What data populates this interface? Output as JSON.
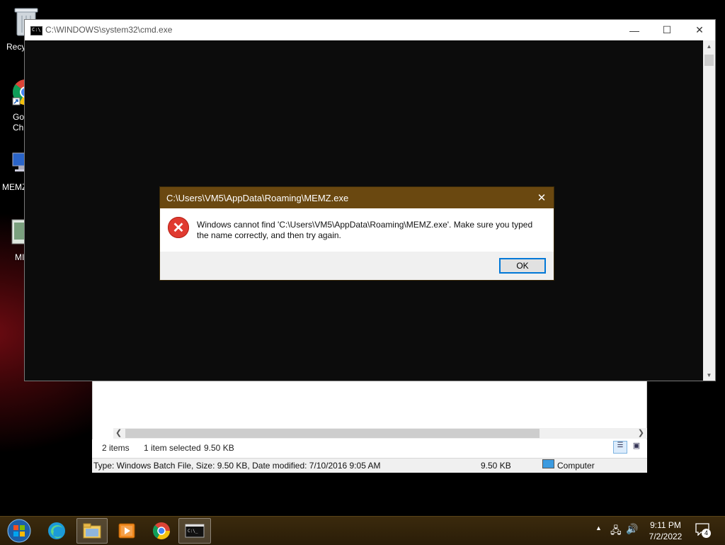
{
  "desktop": {
    "icons": [
      {
        "name": "recycle-bin",
        "label": "Recy"
      },
      {
        "name": "google-chrome",
        "label": "Go\nChr"
      },
      {
        "name": "memz-computer",
        "label": "MEMZ"
      },
      {
        "name": "memz-file",
        "label": "MI"
      }
    ]
  },
  "cmd": {
    "title": "C:\\WINDOWS\\system32\\cmd.exe",
    "minimize": "—",
    "maximize": "☐",
    "close": "✕"
  },
  "explorer": {
    "items_count": "2 items",
    "selected": "1 item selected",
    "selected_size": "9.50 KB",
    "detail": "Type: Windows Batch File, Size: 9.50 KB, Date modified: 7/10/2016 9:05 AM",
    "detail_size": "9.50 KB",
    "location": "Computer"
  },
  "dialog": {
    "title": "C:\\Users\\VM5\\AppData\\Roaming\\MEMZ.exe",
    "message": "Windows cannot find 'C:\\Users\\VM5\\AppData\\Roaming\\MEMZ.exe'. Make sure you typed the name correctly, and then try again.",
    "ok_label": "OK",
    "close": "✕"
  },
  "taskbar": {
    "time": "9:11 PM",
    "date": "7/2/2022",
    "notification_count": "4"
  },
  "colors": {
    "dialog_titlebar": "#6a4810",
    "taskbar": "#3b2a0d",
    "error": "#e03a30",
    "accent": "#0078d7"
  }
}
